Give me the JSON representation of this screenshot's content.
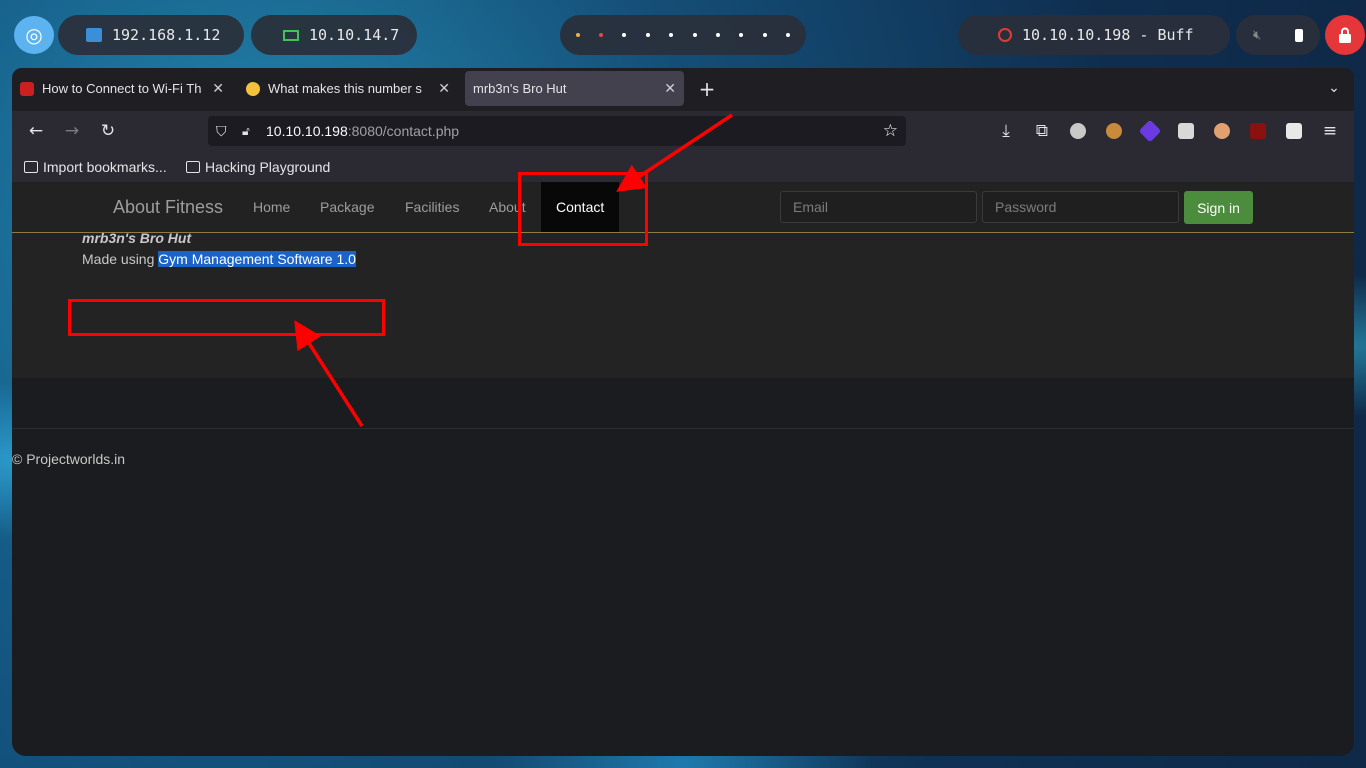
{
  "taskbar": {
    "local_ip": "192.168.1.12",
    "vpn_ip": "10.10.14.7",
    "target": "10.10.10.198 - Buff"
  },
  "browser": {
    "tabs": [
      {
        "title": "How to Connect to Wi-Fi Th"
      },
      {
        "title": "What makes this number s"
      },
      {
        "title": "mrb3n's Bro Hut"
      }
    ],
    "url_host": "10.10.10.198",
    "url_path": ":8080/contact.php",
    "bookmarks": [
      "Import bookmarks...",
      "Hacking Playground"
    ]
  },
  "site": {
    "brand": "About Fitness",
    "nav": [
      "Home",
      "Package",
      "Facilities",
      "About",
      "Contact"
    ],
    "email_placeholder": "Email",
    "password_placeholder": "Password",
    "signin_label": "Sign in",
    "title": "mrb3n's Bro Hut",
    "made_prefix": "Made using ",
    "made_link": "Gym Management Software 1.0",
    "footer": "© Projectworlds.in"
  },
  "colors": {
    "highlight": "#1a63c9",
    "annotation": "#ff0000",
    "signin": "#4b8d3d"
  }
}
